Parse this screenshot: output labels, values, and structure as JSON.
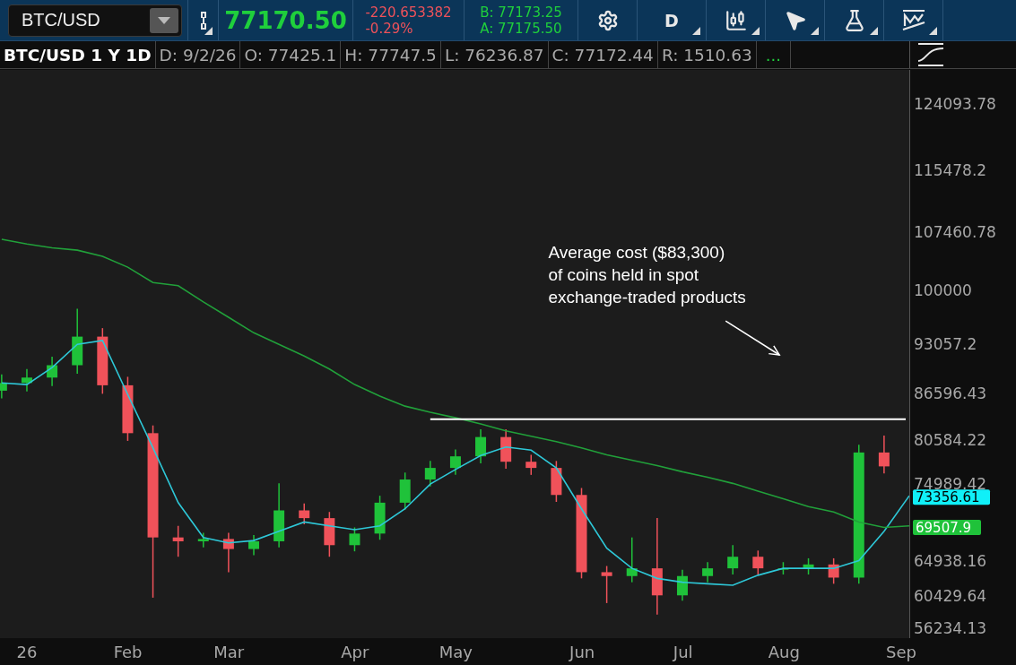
{
  "toolbar": {
    "symbol": "BTC/USD",
    "last": "77170.50",
    "change": "-220.653382",
    "change_pct": "-0.29%",
    "bid": "B: 77173.25",
    "ask": "A: 77175.50",
    "interval": "D"
  },
  "header": {
    "title": "BTC/USD 1 Y 1D",
    "fields": [
      "D: 9/2/26",
      "O: 77425.1",
      "H: 77747.5",
      "L: 76236.87",
      "C: 77172.44",
      "R: 1510.63"
    ],
    "more": "..."
  },
  "chart": {
    "chart_data": {
      "type": "candlestick",
      "categories": [
        null,
        "26",
        null,
        null,
        null,
        "Feb",
        null,
        null,
        null,
        "Mar",
        null,
        null,
        null,
        null,
        "Apr",
        null,
        null,
        null,
        "May",
        null,
        null,
        null,
        null,
        "Jun",
        null,
        null,
        null,
        "Jul",
        null,
        null,
        null,
        "Aug",
        null,
        null,
        null,
        null,
        "Sep"
      ],
      "ohlc": [
        [
          87000,
          89100,
          86000,
          88000
        ],
        [
          88000,
          89800,
          86900,
          88700
        ],
        [
          88700,
          91400,
          87600,
          90300
        ],
        [
          90300,
          97600,
          89200,
          94000
        ],
        [
          94000,
          95100,
          86600,
          87700
        ],
        [
          87700,
          88800,
          80500,
          81500
        ],
        [
          81500,
          82500,
          60200,
          68000
        ],
        [
          68000,
          69500,
          65500,
          67500
        ],
        [
          67500,
          68600,
          66700,
          67800
        ],
        [
          67800,
          68600,
          63500,
          66500
        ],
        [
          66500,
          68300,
          65700,
          67500
        ],
        [
          67500,
          75000,
          66700,
          71500
        ],
        [
          71500,
          72400,
          69700,
          70500
        ],
        [
          70500,
          71300,
          65500,
          67000
        ],
        [
          67000,
          69300,
          66200,
          68500
        ],
        [
          68500,
          73400,
          67700,
          72500
        ],
        [
          72500,
          76400,
          71600,
          75500
        ],
        [
          75500,
          77900,
          74600,
          77000
        ],
        [
          77000,
          79400,
          76100,
          78500
        ],
        [
          78500,
          82000,
          77600,
          81000
        ],
        [
          81000,
          82000,
          76900,
          77800
        ],
        [
          77800,
          78700,
          76100,
          77000
        ],
        [
          77000,
          77900,
          72600,
          73500
        ],
        [
          73500,
          74400,
          62700,
          63500
        ],
        [
          63500,
          64300,
          59500,
          63000
        ],
        [
          63000,
          68000,
          62200,
          64000
        ],
        [
          64000,
          70500,
          58000,
          60500
        ],
        [
          60500,
          63800,
          59800,
          63000
        ],
        [
          63000,
          64800,
          62200,
          64000
        ],
        [
          64000,
          67000,
          63200,
          65500
        ],
        [
          65500,
          66300,
          63200,
          64000
        ],
        [
          64000,
          64800,
          63200,
          64000
        ],
        [
          64000,
          65300,
          63200,
          64500
        ],
        [
          64500,
          65300,
          62000,
          62800
        ],
        [
          62800,
          80000,
          62000,
          79000
        ],
        [
          79000,
          81200,
          76300,
          77200
        ],
        null
      ],
      "series": [
        {
          "type": "line",
          "color": "#2ec8d8",
          "values": [
            88000,
            87800,
            90000,
            93000,
            93500,
            86500,
            79600,
            72500,
            68000,
            67300,
            67600,
            68800,
            70000,
            69500,
            69000,
            69500,
            71700,
            74900,
            76800,
            78600,
            79700,
            79300,
            77000,
            71700,
            66600,
            64000,
            62700,
            62200,
            62000,
            61800,
            63100,
            64000,
            64000,
            64000,
            65000,
            68800,
            73400
          ]
        },
        {
          "type": "line",
          "color": "#21a03a",
          "values": [
            106600,
            106000,
            105500,
            105200,
            104400,
            103000,
            101000,
            100600,
            98500,
            96500,
            94500,
            93000,
            91500,
            89800,
            87800,
            86300,
            85000,
            84200,
            83500,
            82700,
            81800,
            81100,
            80400,
            79600,
            78700,
            78000,
            77300,
            76500,
            75800,
            75000,
            74000,
            73000,
            72000,
            71300,
            70000,
            69300,
            69500
          ]
        },
        {
          "type": "line",
          "color": "#ffffff",
          "values": [
            null,
            null,
            null,
            null,
            null,
            null,
            null,
            null,
            null,
            null,
            null,
            null,
            null,
            null,
            null,
            null,
            null,
            83300,
            83300,
            83300,
            83300,
            83300,
            83300,
            83300,
            83300,
            83300,
            83300,
            83300,
            83300,
            83300,
            83300,
            83300,
            83300,
            83300,
            83300,
            83300,
            83300
          ]
        }
      ],
      "ylim": [
        55000,
        128500
      ],
      "yticks": [
        124093.78,
        115478.2,
        107460.78,
        100000,
        93057.2,
        86596.43,
        80584.22,
        74989.42,
        64938.16,
        60429.64,
        56234.13
      ],
      "annotations": [
        "Average cost ($83,300)\nof coins held in spot\nexchange-traded products"
      ]
    }
  },
  "axis_badges": [
    {
      "text": "73356.61",
      "color": "#10f0f8"
    },
    {
      "text": "69507.9",
      "color": "#1fc23a"
    }
  ]
}
